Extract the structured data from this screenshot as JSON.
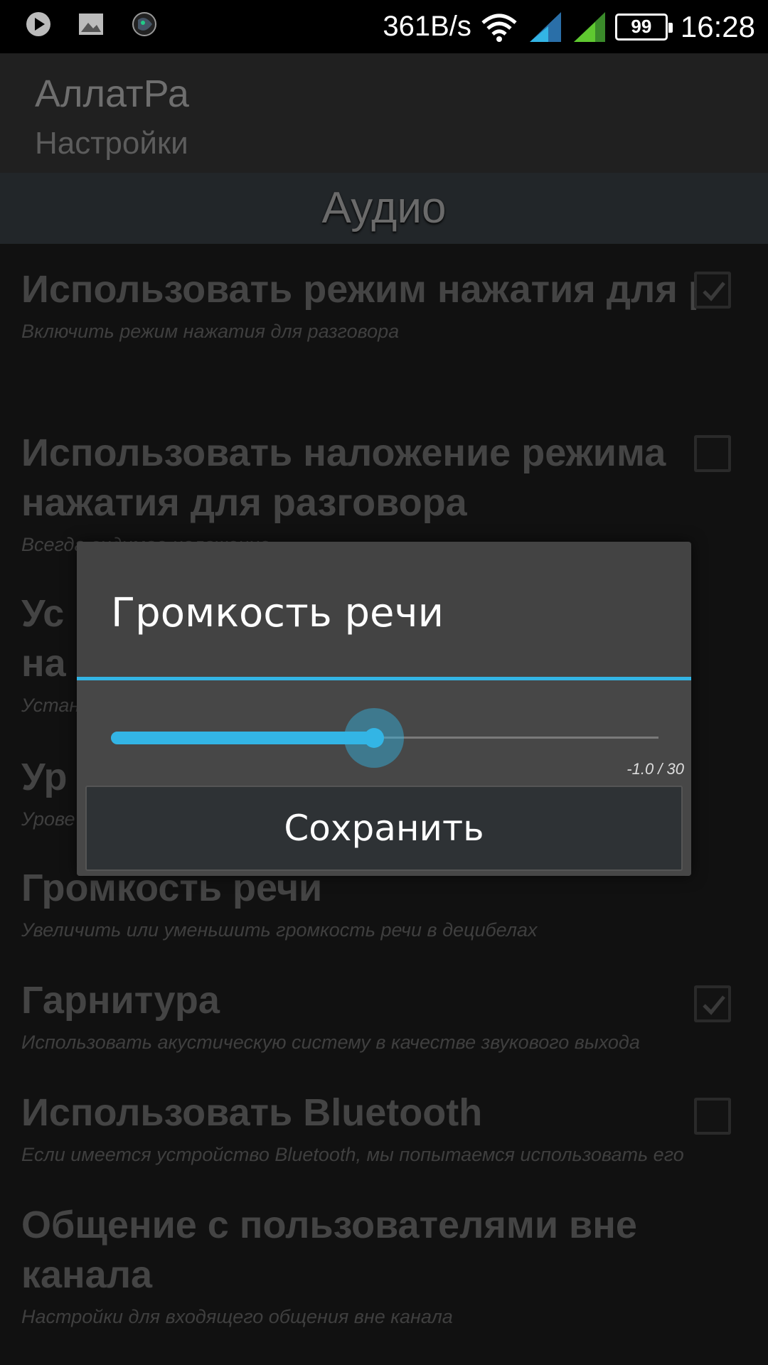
{
  "status_bar": {
    "left_icons": [
      "play-icon",
      "image-icon",
      "app-notification-icon"
    ],
    "speed": "361B/s",
    "battery": "99",
    "time": "16:28"
  },
  "header": {
    "title": "АллатРа",
    "subtitle": "Настройки"
  },
  "section": {
    "title": "Аудио"
  },
  "preferences": [
    {
      "title": "Использовать режим нажатия для разговора",
      "summary": "Включить режим нажатия для разговора",
      "checkbox": true,
      "checked": true
    },
    {
      "title": "Использовать наложение режима нажатия для разговора",
      "summary": "Всегда видимое наложение",
      "checkbox": true,
      "checked": false
    },
    {
      "title": "Ус",
      "title_cont": "на",
      "summary": "Устан"
    },
    {
      "title": "Ур",
      "summary": "Урове"
    },
    {
      "title": "Громкость речи",
      "summary": "Увеличить или уменьшить громкость речи в децибелах"
    },
    {
      "title": "Гарнитура",
      "summary": "Использовать акустическую систему в качестве звукового выхода",
      "checkbox": true,
      "checked": true
    },
    {
      "title": "Использовать Bluetooth",
      "summary": "Если имеется устройство Bluetooth, мы попытаемся использовать его",
      "checkbox": true,
      "checked": false
    },
    {
      "title": "Общение с пользователями вне канала",
      "summary": "Настройки для входящего общения вне канала"
    }
  ],
  "dialog": {
    "title": "Громкость речи",
    "slider_fraction": 0.48,
    "value_text": "-1.0 / 30",
    "save_label": "Сохранить"
  },
  "colors": {
    "accent": "#33b5e5"
  }
}
